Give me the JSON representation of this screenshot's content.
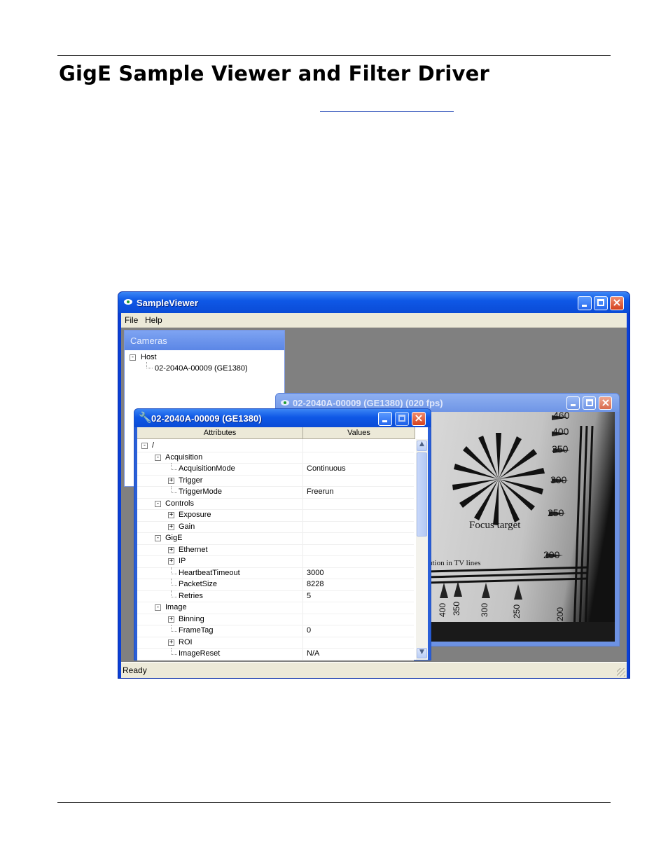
{
  "document": {
    "title": "GigE Sample Viewer and Filter Driver"
  },
  "main_window": {
    "title": "SampleViewer",
    "menu": [
      "File",
      "Help"
    ],
    "status": "Ready"
  },
  "cameras_pane": {
    "title": "Cameras",
    "tree": {
      "root": "Host",
      "child": "02-2040A-00009 (GE1380)"
    }
  },
  "viewer_window": {
    "title": "02-2040A-00009 (GE1380) (020 fps)",
    "image_labels": {
      "focus": "Focus target",
      "tv_lines": "ution in TV lines",
      "right_scale": [
        "460",
        "400",
        "350",
        "300",
        "250",
        "200"
      ],
      "bottom_scale": [
        "400",
        "350",
        "300",
        "250",
        "200"
      ]
    }
  },
  "attributes_window": {
    "title": "02-2040A-00009 (GE1380)",
    "columns": [
      "Attributes",
      "Values"
    ],
    "rows": [
      {
        "name": "/",
        "value": "",
        "level": 0,
        "toggle": "-"
      },
      {
        "name": "Acquisition",
        "value": "",
        "level": 1,
        "toggle": "-"
      },
      {
        "name": "AcquisitionMode",
        "value": "Continuous",
        "level": 2,
        "toggle": ""
      },
      {
        "name": "Trigger",
        "value": "",
        "level": 2,
        "toggle": "+"
      },
      {
        "name": "TriggerMode",
        "value": "Freerun",
        "level": 2,
        "toggle": ""
      },
      {
        "name": "Controls",
        "value": "",
        "level": 1,
        "toggle": "-"
      },
      {
        "name": "Exposure",
        "value": "",
        "level": 2,
        "toggle": "+"
      },
      {
        "name": "Gain",
        "value": "",
        "level": 2,
        "toggle": "+"
      },
      {
        "name": "GigE",
        "value": "",
        "level": 1,
        "toggle": "-"
      },
      {
        "name": "Ethernet",
        "value": "",
        "level": 2,
        "toggle": "+"
      },
      {
        "name": "IP",
        "value": "",
        "level": 2,
        "toggle": "+"
      },
      {
        "name": "HeartbeatTimeout",
        "value": "3000",
        "level": 2,
        "toggle": ""
      },
      {
        "name": "PacketSize",
        "value": "8228",
        "level": 2,
        "toggle": ""
      },
      {
        "name": "Retries",
        "value": "5",
        "level": 2,
        "toggle": ""
      },
      {
        "name": "Image",
        "value": "",
        "level": 1,
        "toggle": "-"
      },
      {
        "name": "Binning",
        "value": "",
        "level": 2,
        "toggle": "+"
      },
      {
        "name": "FrameTag",
        "value": "0",
        "level": 2,
        "toggle": ""
      },
      {
        "name": "ROI",
        "value": "",
        "level": 2,
        "toggle": "+"
      },
      {
        "name": "ImageReset",
        "value": "N/A",
        "level": 2,
        "toggle": ""
      }
    ]
  },
  "colors": {
    "titlebar": "#0f58e6",
    "inactive_titlebar": "#7a9ee8",
    "desktop": "#808080",
    "close_button": "#d4411e"
  }
}
